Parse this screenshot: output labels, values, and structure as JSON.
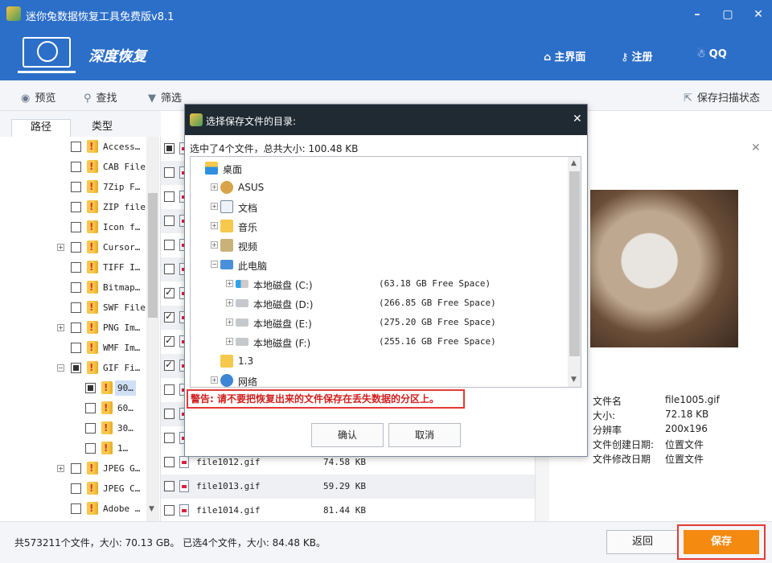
{
  "window": {
    "title": "迷你兔数据恢复工具免费版v8.1",
    "minimize": "–",
    "maximize": "▢",
    "close": "✕"
  },
  "header": {
    "brand": "深度恢复",
    "nav": [
      {
        "icon": "home-icon",
        "label": "主界面"
      },
      {
        "icon": "key-icon",
        "label": "注册"
      },
      {
        "icon": "qq-icon",
        "label": "QQ"
      }
    ]
  },
  "toolbar": {
    "preview": "预览",
    "search": "查找",
    "filter": "筛选",
    "save_scan": "保存扫描状态"
  },
  "tabs": {
    "path": "路径",
    "type": "类型"
  },
  "tree": [
    {
      "label": "Access…",
      "state": "none",
      "indent": 0,
      "expander": ""
    },
    {
      "label": "CAB File",
      "state": "none",
      "indent": 0,
      "expander": ""
    },
    {
      "label": "7Zip F…",
      "state": "none",
      "indent": 0,
      "expander": ""
    },
    {
      "label": "ZIP file",
      "state": "none",
      "indent": 0,
      "expander": ""
    },
    {
      "label": "Icon f…",
      "state": "none",
      "indent": 0,
      "expander": ""
    },
    {
      "label": "Cursor…",
      "state": "none",
      "indent": 0,
      "expander": "+"
    },
    {
      "label": "TIFF I…",
      "state": "none",
      "indent": 0,
      "expander": ""
    },
    {
      "label": "Bitmap…",
      "state": "none",
      "indent": 0,
      "expander": ""
    },
    {
      "label": "SWF File",
      "state": "none",
      "indent": 0,
      "expander": ""
    },
    {
      "label": "PNG Im…",
      "state": "none",
      "indent": 0,
      "expander": "+"
    },
    {
      "label": "WMF Im…",
      "state": "none",
      "indent": 0,
      "expander": ""
    },
    {
      "label": "GIF Fi…",
      "state": "partial",
      "indent": 0,
      "expander": "−"
    },
    {
      "label": "90…",
      "state": "partial",
      "indent": 1,
      "expander": "",
      "selected": true
    },
    {
      "label": "60…",
      "state": "none",
      "indent": 1,
      "expander": ""
    },
    {
      "label": "30…",
      "state": "none",
      "indent": 1,
      "expander": ""
    },
    {
      "label": "1…",
      "state": "none",
      "indent": 1,
      "expander": ""
    },
    {
      "label": "JPEG G…",
      "state": "none",
      "indent": 0,
      "expander": "+"
    },
    {
      "label": "JPEG C…",
      "state": "none",
      "indent": 0,
      "expander": ""
    },
    {
      "label": "Adobe …",
      "state": "none",
      "indent": 0,
      "expander": ""
    }
  ],
  "files": [
    {
      "name": "file1012.gif",
      "size": "74.58 KB",
      "checked": false
    },
    {
      "name": "file1013.gif",
      "size": "59.29 KB",
      "checked": false
    },
    {
      "name": "file1014.gif",
      "size": "81.44 KB",
      "checked": false
    }
  ],
  "list_checks": [
    "partial",
    "none",
    "none",
    "none",
    "none",
    "none",
    "checked",
    "checked",
    "checked",
    "checked",
    "none",
    "none",
    "none"
  ],
  "info": {
    "filename_label": "文件名",
    "filename": "file1005.gif",
    "size_label": "大小:",
    "size": "72.18 KB",
    "resolution_label": "分辨率",
    "resolution": "200x196",
    "created_label": "文件创建日期:",
    "created": "位置文件",
    "modified_label": "文件修改日期",
    "modified": "位置文件"
  },
  "status": {
    "summary": "共573211个文件，大小: 70.13 GB。 已选4个文件，大小: 84.48 KB。",
    "back": "返回",
    "save": "保存"
  },
  "dialog": {
    "title": "选择保存文件的目录:",
    "close": "✕",
    "summary": "选中了4个文件，总共大小: 100.48 KB",
    "items": [
      {
        "name": "桌面",
        "indent": 0,
        "expander": "",
        "icon": "desktop",
        "free": ""
      },
      {
        "name": "ASUS",
        "indent": 1,
        "expander": "+",
        "icon": "user",
        "free": ""
      },
      {
        "name": "文档",
        "indent": 1,
        "expander": "+",
        "icon": "docs",
        "free": ""
      },
      {
        "name": "音乐",
        "indent": 1,
        "expander": "+",
        "icon": "music",
        "free": ""
      },
      {
        "name": "视频",
        "indent": 1,
        "expander": "+",
        "icon": "video",
        "free": ""
      },
      {
        "name": "此电脑",
        "indent": 1,
        "expander": "−",
        "icon": "computer",
        "free": ""
      },
      {
        "name": "本地磁盘 (C:)",
        "indent": 2,
        "expander": "+",
        "icon": "windrive",
        "free": "(63.18 GB Free Space)"
      },
      {
        "name": "本地磁盘 (D:)",
        "indent": 2,
        "expander": "+",
        "icon": "drive",
        "free": "(266.85 GB Free Space)"
      },
      {
        "name": "本地磁盘 (E:)",
        "indent": 2,
        "expander": "+",
        "icon": "drive",
        "free": "(275.20 GB Free Space)"
      },
      {
        "name": "本地磁盘 (F:)",
        "indent": 2,
        "expander": "+",
        "icon": "drive",
        "free": "(255.16 GB Free Space)"
      },
      {
        "name": "1.3",
        "indent": 1,
        "expander": "",
        "icon": "folder",
        "free": ""
      },
      {
        "name": "网络",
        "indent": 1,
        "expander": "+",
        "icon": "network",
        "free": ""
      }
    ],
    "warning": "警告: 请不要把恢复出来的文件保存在丢失数据的分区上。",
    "ok": "确认",
    "cancel": "取消"
  },
  "colors": {
    "header_bg": "#2c6fc9",
    "dialog_title_bg": "#1f2a33",
    "save_btn": "#f58a10",
    "warning_red": "#e53935"
  }
}
